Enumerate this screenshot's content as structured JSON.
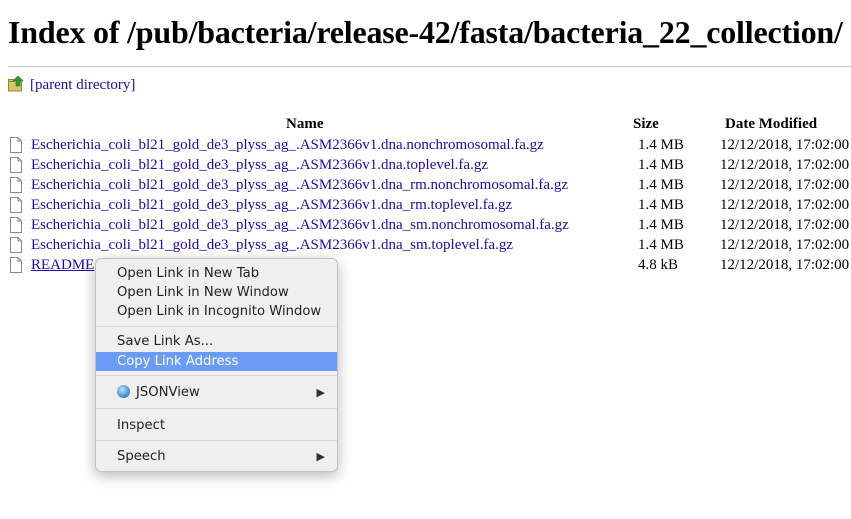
{
  "page": {
    "title": "Index of /pub/bacteria/release-42/fasta/bacteria_22_collection/",
    "parent_link": "[parent directory]"
  },
  "table": {
    "headers": {
      "name": "Name",
      "size": "Size",
      "date": "Date Modified"
    },
    "rows": [
      {
        "name": "Escherichia_coli_bl21_gold_de3_plyss_ag_.ASM2366v1.dna.nonchromosomal.fa.gz",
        "size": "1.4 MB",
        "date": "12/12/2018, 17:02:00"
      },
      {
        "name": "Escherichia_coli_bl21_gold_de3_plyss_ag_.ASM2366v1.dna.toplevel.fa.gz",
        "size": "1.4 MB",
        "date": "12/12/2018, 17:02:00"
      },
      {
        "name": "Escherichia_coli_bl21_gold_de3_plyss_ag_.ASM2366v1.dna_rm.nonchromosomal.fa.gz",
        "size": "1.4 MB",
        "date": "12/12/2018, 17:02:00"
      },
      {
        "name": "Escherichia_coli_bl21_gold_de3_plyss_ag_.ASM2366v1.dna_rm.toplevel.fa.gz",
        "size": "1.4 MB",
        "date": "12/12/2018, 17:02:00"
      },
      {
        "name": "Escherichia_coli_bl21_gold_de3_plyss_ag_.ASM2366v1.dna_sm.nonchromosomal.fa.gz",
        "size": "1.4 MB",
        "date": "12/12/2018, 17:02:00"
      },
      {
        "name": "Escherichia_coli_bl21_gold_de3_plyss_ag_.ASM2366v1.dna_sm.toplevel.fa.gz",
        "size": "1.4 MB",
        "date": "12/12/2018, 17:02:00"
      },
      {
        "name": "README",
        "size": "4.8 kB",
        "date": "12/12/2018, 17:02:00"
      }
    ]
  },
  "context_menu": {
    "open_new_tab": "Open Link in New Tab",
    "open_new_window": "Open Link in New Window",
    "open_incognito": "Open Link in Incognito Window",
    "save_link_as": "Save Link As...",
    "copy_link_address": "Copy Link Address",
    "jsonview": "JSONView",
    "inspect": "Inspect",
    "speech": "Speech",
    "submenu_arrow": "▶",
    "highlighted_color": "#6a9cf5"
  },
  "icons": {
    "parent": "folder-up-icon",
    "file": "file-icon",
    "jsonview": "jsonview-icon"
  },
  "colors": {
    "link": "#1a0dab"
  }
}
